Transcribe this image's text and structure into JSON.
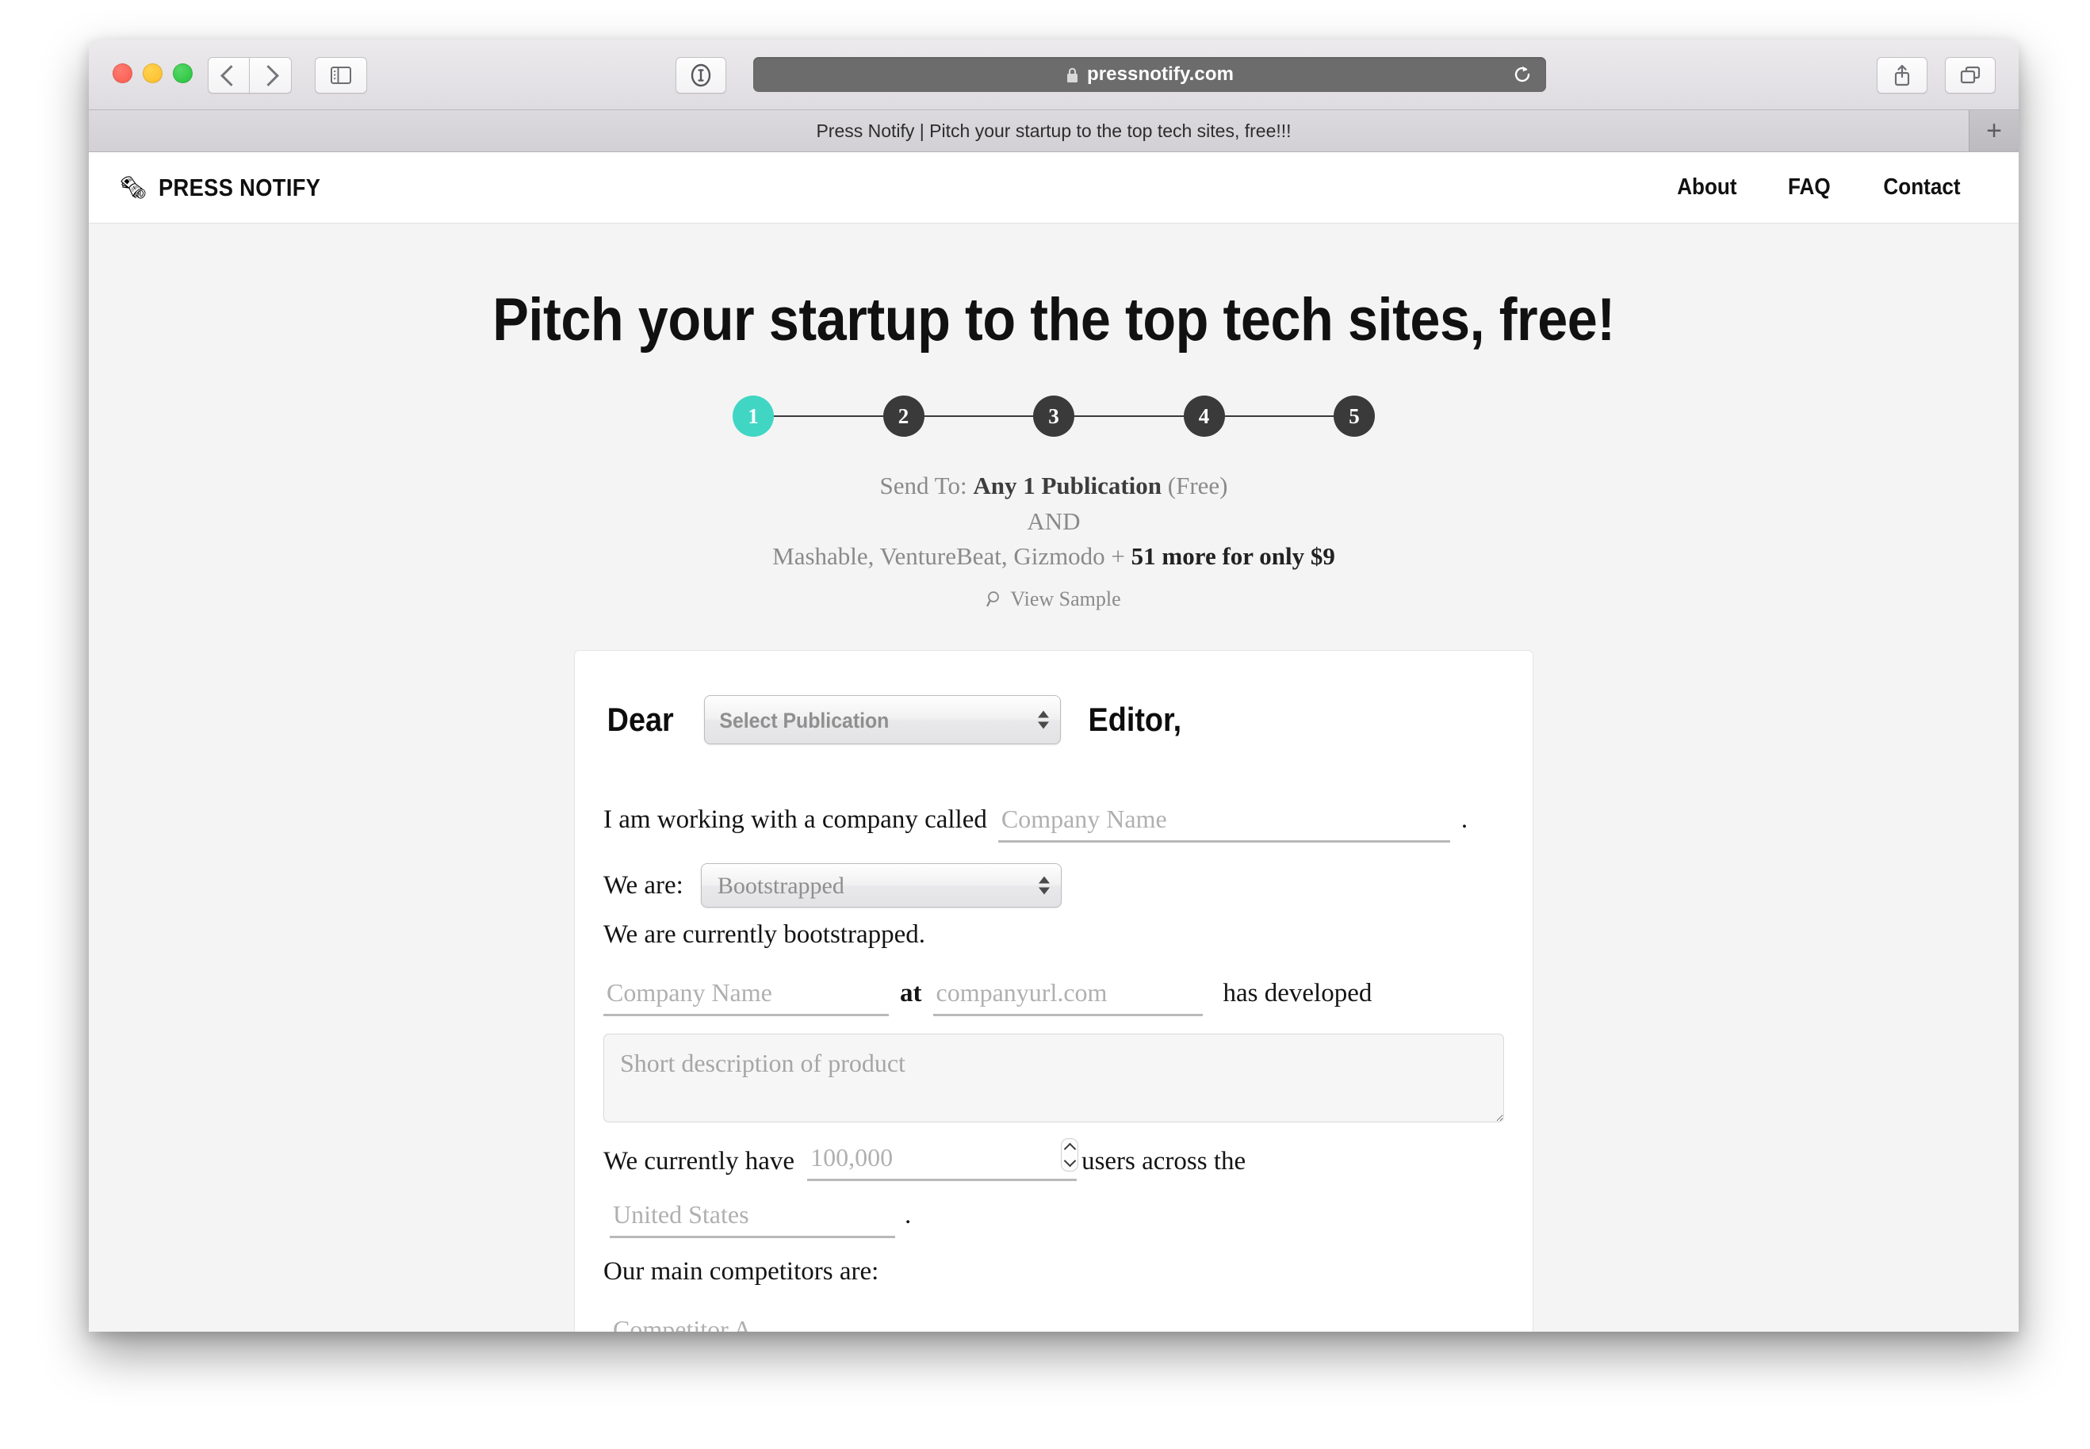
{
  "browser": {
    "url": "pressnotify.com",
    "lock_icon": "lock-icon",
    "reload_icon": "reload-icon",
    "back_icon": "chevron-left-icon",
    "forward_icon": "chevron-right-icon",
    "sidebar_icon": "sidebar-icon",
    "reader_icon": "reader-mode-icon",
    "share_icon": "share-icon",
    "tabs_icon": "tab-overview-icon",
    "new_tab_label": "+",
    "tab_title": "Press Notify | Pitch your startup to the top tech sites, free!!!"
  },
  "site": {
    "brand_icon": "rolled-newspaper-icon",
    "brand_name": "PRESS NOTIFY",
    "nav": [
      {
        "label": "About"
      },
      {
        "label": "FAQ"
      },
      {
        "label": "Contact"
      }
    ]
  },
  "hero": {
    "headline": "Pitch your startup to the top tech sites, free!",
    "steps": [
      {
        "number": "1",
        "active": true
      },
      {
        "number": "2",
        "active": false
      },
      {
        "number": "3",
        "active": false
      },
      {
        "number": "4",
        "active": false
      },
      {
        "number": "5",
        "active": false
      }
    ],
    "send_to_label": "Send To:",
    "send_to_free_plan": "Any 1 Publication",
    "send_to_free_note": "(Free)",
    "and_label": "AND",
    "paid_publications": "Mashable, VentureBeat, Gizmodo +",
    "paid_offer": "51 more for only $9",
    "view_sample_icon": "magnifier-icon",
    "view_sample_label": "View Sample",
    "active_step_color": "#41d6c3",
    "inactive_step_color": "#3a3a3a"
  },
  "form": {
    "salutation": "Dear",
    "publication_select_value": "Select Publication",
    "salutation_end": "Editor,",
    "line_working_with": "I am working with a company called",
    "company_name_placeholder": "Company Name",
    "period": ".",
    "we_are_label": "We are:",
    "funding_select_value": "Bootstrapped",
    "funding_sentence": "We are currently bootstrapped.",
    "at_label": "at",
    "company_url_placeholder": "companyurl.com",
    "has_developed_label": "has developed",
    "description_placeholder": "Short description of product",
    "we_currently_have_label": "We currently have",
    "users_placeholder": "100,000",
    "users_across_label": "users across the",
    "country_placeholder": "United States",
    "competitors_label": "Our main competitors are:",
    "competitor_a_placeholder": "Competitor A"
  }
}
